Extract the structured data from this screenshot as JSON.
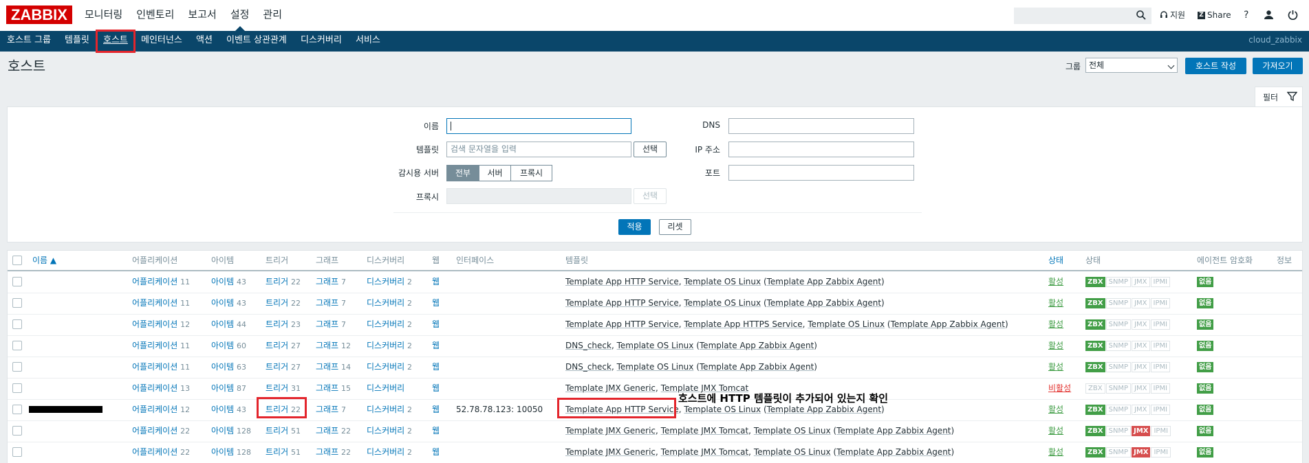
{
  "app": {
    "logo": "ZABBIX"
  },
  "main_nav": [
    "모니터링",
    "인벤토리",
    "보고서",
    "설정",
    "관리"
  ],
  "top_right": {
    "support": "지원",
    "share": "Share",
    "help": "?"
  },
  "sub_nav": [
    "호스트 그룹",
    "템플릿",
    "호스트",
    "메인터넌스",
    "액션",
    "이벤트 상관관계",
    "디스커버리",
    "서비스"
  ],
  "user": "cloud_zabbix",
  "page_title": "호스트",
  "header": {
    "group_label": "그룹",
    "group_value": "전체",
    "create_btn": "호스트 작성",
    "import_btn": "가져오기"
  },
  "filter": {
    "tab_label": "필터",
    "name_label": "이름",
    "template_label": "템플릿",
    "template_placeholder": "검색 문자열을 입력",
    "select_btn": "선택",
    "monitored_by_label": "감시용 서버",
    "monitored_opts": [
      "전부",
      "서버",
      "프록시"
    ],
    "proxy_label": "프록시",
    "dns_label": "DNS",
    "ip_label": "IP 주소",
    "port_label": "포트",
    "apply_btn": "적용",
    "reset_btn": "리셋"
  },
  "table": {
    "headers": {
      "name": "이름 ▲",
      "apps": "어플리케이션",
      "items": "아이템",
      "triggers": "트리거",
      "graphs": "그래프",
      "discovery": "디스커버리",
      "web": "웹",
      "interface": "인터페이스",
      "templates": "템플릿",
      "status": "상태",
      "availability": "상태",
      "encryption": "에이전트 암호화",
      "info": "정보"
    },
    "rows": [
      {
        "apps": "어플리케이션",
        "apps_n": "11",
        "items": "아이템",
        "items_n": "43",
        "triggers": "트리거",
        "triggers_n": "22",
        "graphs": "그래프",
        "graphs_n": "7",
        "disc": "디스커버리",
        "disc_n": "2",
        "web": "웹",
        "iface": "",
        "tpl": [
          [
            "Template App HTTP Service",
            ", "
          ],
          [
            "Template OS Linux",
            " ("
          ],
          [
            "Template App Zabbix Agent",
            ")"
          ]
        ],
        "status": "활성",
        "avail": [
          "on",
          "off",
          "off",
          "off"
        ],
        "enc": "없음"
      },
      {
        "apps": "어플리케이션",
        "apps_n": "11",
        "items": "아이템",
        "items_n": "43",
        "triggers": "트리거",
        "triggers_n": "22",
        "graphs": "그래프",
        "graphs_n": "7",
        "disc": "디스커버리",
        "disc_n": "2",
        "web": "웹",
        "iface": "",
        "tpl": [
          [
            "Template App HTTP Service",
            ", "
          ],
          [
            "Template OS Linux",
            " ("
          ],
          [
            "Template App Zabbix Agent",
            ")"
          ]
        ],
        "status": "활성",
        "avail": [
          "on",
          "off",
          "off",
          "off"
        ],
        "enc": "없음"
      },
      {
        "apps": "어플리케이션",
        "apps_n": "12",
        "items": "아이템",
        "items_n": "44",
        "triggers": "트리거",
        "triggers_n": "23",
        "graphs": "그래프",
        "graphs_n": "7",
        "disc": "디스커버리",
        "disc_n": "2",
        "web": "웹",
        "iface": "",
        "tpl": [
          [
            "Template App HTTP Service",
            ", "
          ],
          [
            "Template App HTTPS Service",
            ", "
          ],
          [
            "Template OS Linux",
            " ("
          ],
          [
            "Template App Zabbix Agent",
            ")"
          ]
        ],
        "status": "활성",
        "avail": [
          "on",
          "off",
          "off",
          "off"
        ],
        "enc": "없음"
      },
      {
        "apps": "어플리케이션",
        "apps_n": "11",
        "items": "아이템",
        "items_n": "60",
        "triggers": "트리거",
        "triggers_n": "27",
        "graphs": "그래프",
        "graphs_n": "12",
        "disc": "디스커버리",
        "disc_n": "2",
        "web": "웹",
        "iface": "",
        "tpl": [
          [
            "DNS_check",
            ", "
          ],
          [
            "Template OS Linux",
            " ("
          ],
          [
            "Template App Zabbix Agent",
            ")"
          ]
        ],
        "status": "활성",
        "avail": [
          "on",
          "off",
          "off",
          "off"
        ],
        "enc": "없음"
      },
      {
        "apps": "어플리케이션",
        "apps_n": "11",
        "items": "아이템",
        "items_n": "63",
        "triggers": "트리거",
        "triggers_n": "27",
        "graphs": "그래프",
        "graphs_n": "14",
        "disc": "디스커버리",
        "disc_n": "2",
        "web": "웹",
        "iface": "",
        "tpl": [
          [
            "DNS_check",
            ", "
          ],
          [
            "Template OS Linux",
            " ("
          ],
          [
            "Template App Zabbix Agent",
            ")"
          ]
        ],
        "status": "활성",
        "avail": [
          "on",
          "off",
          "off",
          "off"
        ],
        "enc": "없음"
      },
      {
        "apps": "어플리케이션",
        "apps_n": "13",
        "items": "아이템",
        "items_n": "87",
        "triggers": "트리거",
        "triggers_n": "31",
        "graphs": "그래프",
        "graphs_n": "15",
        "disc": "디스커버리",
        "disc_n": "",
        "web": "웹",
        "iface": "",
        "tpl": [
          [
            "Template JMX Generic",
            ", "
          ],
          [
            "Template JMX Tomcat",
            ""
          ]
        ],
        "status": "비활성",
        "avail": [
          "off",
          "off",
          "off",
          "off"
        ],
        "enc": "없음"
      },
      {
        "apps": "어플리케이션",
        "apps_n": "12",
        "items": "아이템",
        "items_n": "43",
        "triggers": "트리거",
        "triggers_n": "22",
        "graphs": "그래프",
        "graphs_n": "7",
        "disc": "디스커버리",
        "disc_n": "2",
        "web": "웹",
        "iface": "52.78.78.123: 10050",
        "tpl": [
          [
            "Template App HTTP Service",
            ", "
          ],
          [
            "Template OS Linux",
            " ("
          ],
          [
            "Template App Zabbix Agent",
            ")"
          ]
        ],
        "status": "활성",
        "avail": [
          "on",
          "off",
          "off",
          "off"
        ],
        "enc": "없음"
      },
      {
        "apps": "어플리케이션",
        "apps_n": "22",
        "items": "아이템",
        "items_n": "128",
        "triggers": "트리거",
        "triggers_n": "51",
        "graphs": "그래프",
        "graphs_n": "22",
        "disc": "디스커버리",
        "disc_n": "2",
        "web": "웹",
        "iface": "",
        "tpl": [
          [
            "Template JMX Generic",
            ", "
          ],
          [
            "Template JMX Tomcat",
            ", "
          ],
          [
            "Template OS Linux",
            " ("
          ],
          [
            "Template App Zabbix Agent",
            ")"
          ]
        ],
        "status": "활성",
        "avail": [
          "on",
          "off",
          "err",
          "off"
        ],
        "enc": "없음"
      },
      {
        "apps": "어플리케이션",
        "apps_n": "22",
        "items": "아이템",
        "items_n": "128",
        "triggers": "트리거",
        "triggers_n": "51",
        "graphs": "그래프",
        "graphs_n": "22",
        "disc": "디스커버리",
        "disc_n": "2",
        "web": "웹",
        "iface": "",
        "tpl": [
          [
            "Template JMX Generic",
            ", "
          ],
          [
            "Template JMX Tomcat",
            ", "
          ],
          [
            "Template OS Linux",
            " ("
          ],
          [
            "Template App Zabbix Agent",
            ")"
          ]
        ],
        "status": "활성",
        "avail": [
          "on",
          "off",
          "err",
          "off"
        ],
        "enc": "없음"
      }
    ],
    "avail_labels": [
      "ZBX",
      "SNMP",
      "JMX",
      "IPMI"
    ]
  },
  "annotation": "호스트에 HTTP 템플릿이 추가되어 있는지 확인",
  "colors": {
    "brand": "#d40000",
    "subnav": "#0a466a",
    "link": "#0275b8",
    "active": "#429e47",
    "inactive": "#e33734",
    "highlight": "#e3252c"
  }
}
